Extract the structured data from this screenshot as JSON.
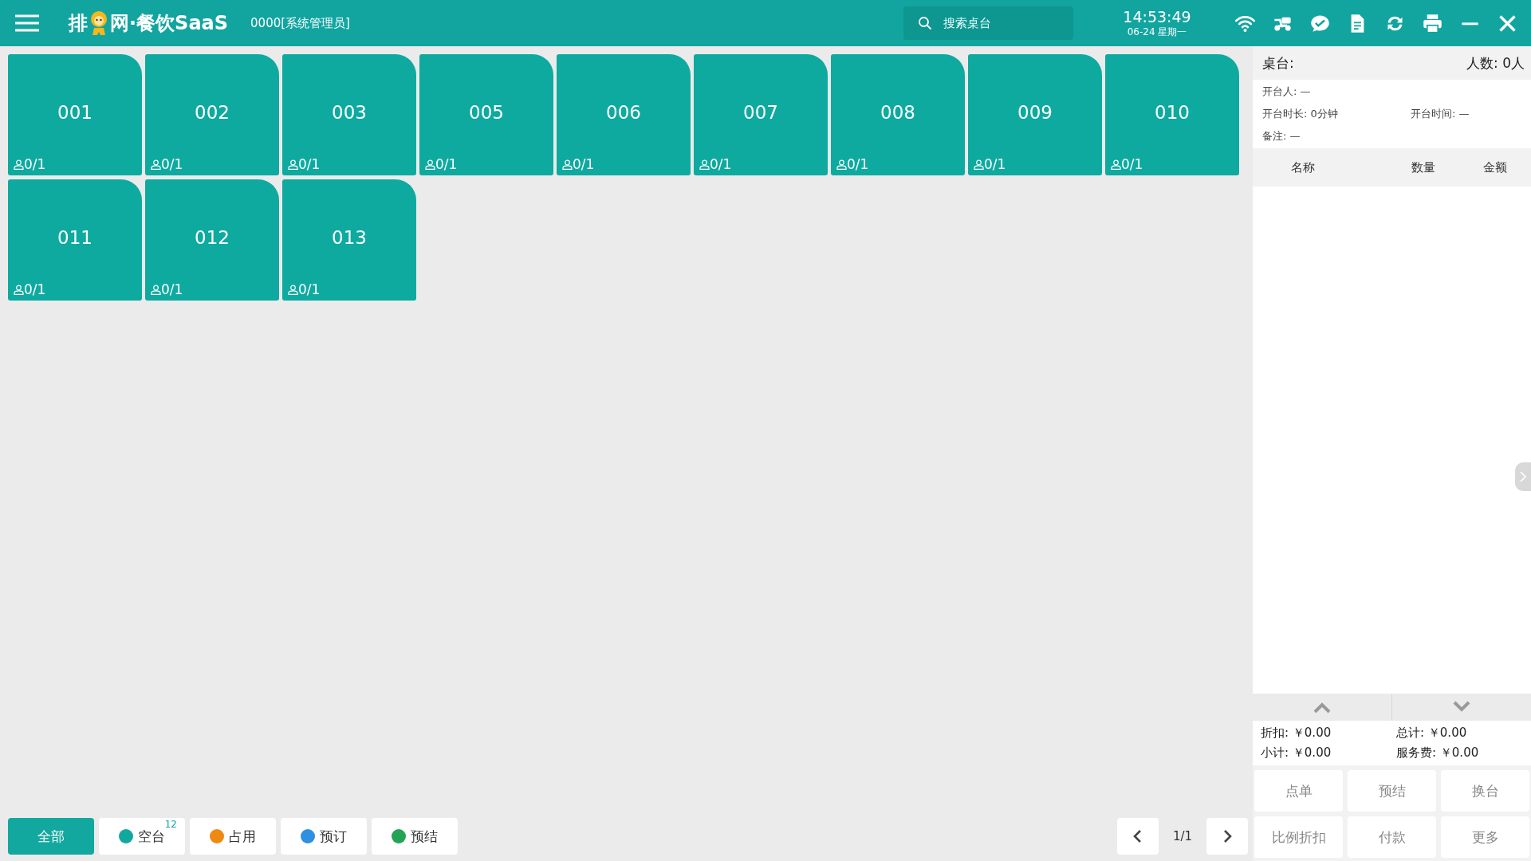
{
  "top_bar": {
    "logo_start": "排",
    "logo_end": "网·餐饮SaaS",
    "user": "0000[系统管理员]",
    "search": {
      "placeholder": "搜索桌台"
    },
    "time": "14:53:49",
    "date": "06-24 星期一"
  },
  "tables": [
    {
      "name": "001",
      "guests": "0/1"
    },
    {
      "name": "002",
      "guests": "0/1"
    },
    {
      "name": "003",
      "guests": "0/1"
    },
    {
      "name": "005",
      "guests": "0/1"
    },
    {
      "name": "006",
      "guests": "0/1"
    },
    {
      "name": "007",
      "guests": "0/1"
    },
    {
      "name": "008",
      "guests": "0/1"
    },
    {
      "name": "009",
      "guests": "0/1"
    },
    {
      "name": "010",
      "guests": "0/1"
    },
    {
      "name": "011",
      "guests": "0/1"
    },
    {
      "name": "012",
      "guests": "0/1"
    },
    {
      "name": "013",
      "guests": "0/1"
    }
  ],
  "filters": [
    {
      "kind": "all",
      "label": "全部",
      "selected": true
    },
    {
      "kind": "status",
      "label": "空台",
      "color": "#12a89f",
      "count": "12",
      "selected": false
    },
    {
      "kind": "status",
      "label": "占用",
      "color": "#ee8a12",
      "selected": false
    },
    {
      "kind": "status",
      "label": "预订",
      "color": "#2f8fe0",
      "selected": false
    },
    {
      "kind": "status",
      "label": "预结",
      "color": "#22a355",
      "selected": false
    }
  ],
  "pager": {
    "page": "1/1"
  },
  "detail": {
    "table_label": "桌台:",
    "people": "人数: 0人",
    "opener": "开台人: —",
    "duration": "开台时长: 0分钟",
    "open_time": "开台时间: —",
    "note": "备注: —",
    "columns": [
      "名称",
      "数量",
      "金额"
    ],
    "totals": [
      "折扣: ￥0.00",
      "总计: ￥0.00",
      "小计: ￥0.00",
      "服务费: ￥0.00"
    ],
    "actions": [
      "点单",
      "预结",
      "换台",
      "比例折扣",
      "付款",
      "更多"
    ]
  }
}
